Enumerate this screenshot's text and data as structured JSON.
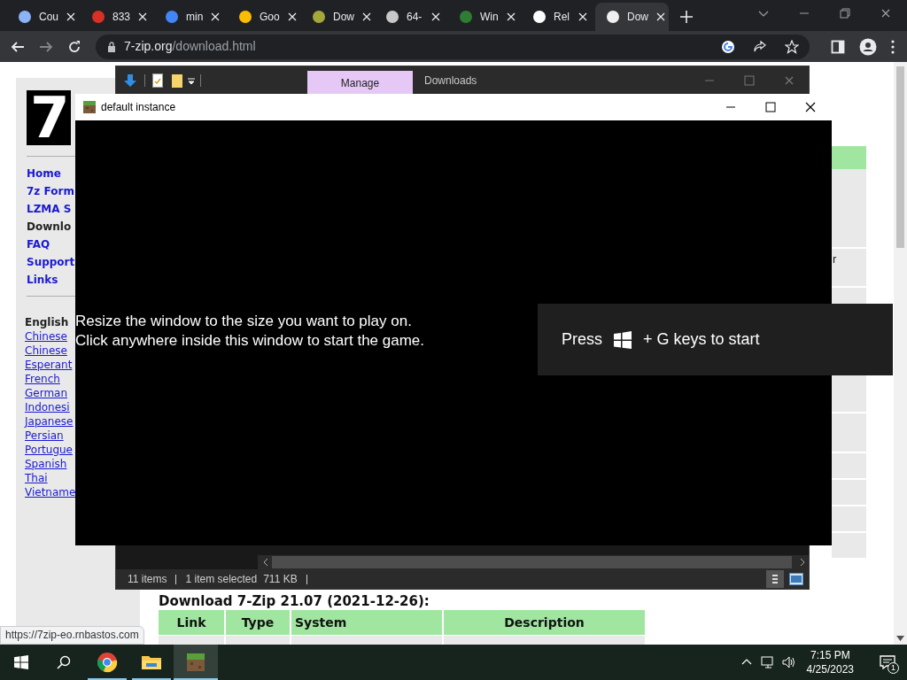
{
  "browser": {
    "tabs": [
      {
        "title": "Cou",
        "color": "#8ab4f8",
        "selected": false
      },
      {
        "title": "833",
        "color": "#d93025",
        "selected": false
      },
      {
        "title": "min",
        "color": "#4285f4",
        "selected": false
      },
      {
        "title": "Goo",
        "color": "#fbbc04",
        "selected": false
      },
      {
        "title": "Dow",
        "color": "#a4a83a",
        "selected": false
      },
      {
        "title": "64-",
        "color": "#c8c8c8",
        "selected": false
      },
      {
        "title": "Win",
        "color": "#2e7d32",
        "selected": false
      },
      {
        "title": "Rel",
        "color": "#ffffff",
        "selected": false
      },
      {
        "title": "Dow",
        "color": "#f0f0f0",
        "selected": true
      }
    ],
    "address": {
      "host": "7-zip.org",
      "path": "/download.html"
    }
  },
  "page": {
    "logo_text": "7",
    "nav": [
      {
        "label": "Home",
        "selected": false
      },
      {
        "label": "7z Form",
        "selected": false
      },
      {
        "label": "LZMA S",
        "selected": false
      },
      {
        "label": "Downlo",
        "selected": true
      },
      {
        "label": "FAQ",
        "selected": false
      },
      {
        "label": "Support",
        "selected": false
      },
      {
        "label": "Links",
        "selected": false
      }
    ],
    "languages": [
      {
        "label": "English",
        "selected": true
      },
      {
        "label": "Chinese",
        "selected": false
      },
      {
        "label": "Chinese",
        "selected": false
      },
      {
        "label": "Esperant",
        "selected": false
      },
      {
        "label": "French",
        "selected": false
      },
      {
        "label": "German",
        "selected": false
      },
      {
        "label": "Indonesi",
        "selected": false
      },
      {
        "label": "Japanese",
        "selected": false
      },
      {
        "label": "Persian",
        "selected": false
      },
      {
        "label": "Portugue",
        "selected": false
      },
      {
        "label": "Spanish",
        "selected": false
      },
      {
        "label": "Thai",
        "selected": false
      },
      {
        "label": "Vietname",
        "selected": false
      }
    ],
    "side_text": "r",
    "heading": "Download 7-Zip 21.07 (2021-12-26):",
    "table": {
      "columns": [
        "Link",
        "Type",
        "System",
        "Description"
      ]
    }
  },
  "status_bubble": "https://7zip-eo.rnbastos.com",
  "explorer": {
    "ribbon_tabs": [
      {
        "label": "Manage",
        "selected": true
      }
    ],
    "title": "Downloads",
    "status": [
      "11 items",
      "1 item selected",
      "711 KB"
    ]
  },
  "game_window": {
    "title": "default instance",
    "messages": [
      "Resize the window to the size you want to play on.",
      "Click anywhere inside this window to start the game."
    ]
  },
  "game_bar_toast": {
    "before": "Press",
    "after": "+ G keys to start"
  },
  "taskbar": {
    "apps": [
      {
        "kind": "chrome",
        "selected": false
      },
      {
        "kind": "folder",
        "selected": false
      },
      {
        "kind": "minecraft",
        "selected": true
      }
    ],
    "time": "7:15 PM",
    "date": "4/25/2023",
    "notifications": "1"
  }
}
